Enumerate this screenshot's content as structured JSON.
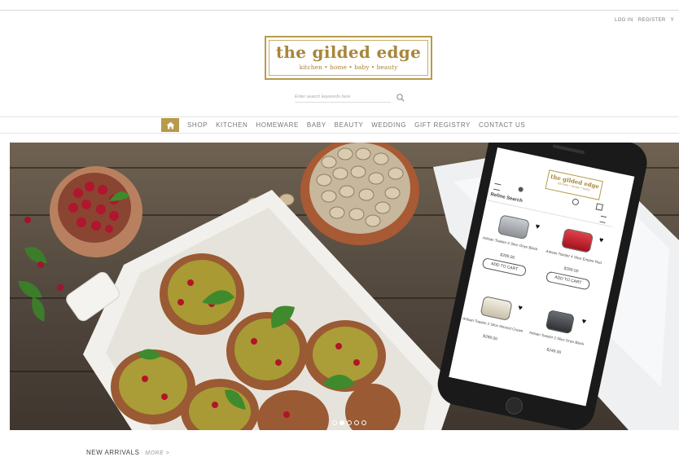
{
  "header": {
    "login": "LOG IN",
    "register": "REGISTER",
    "cart_glyph": "Y"
  },
  "logo": {
    "name": "the gilded edge",
    "tagline": "kitchen • home • baby • beauty"
  },
  "search": {
    "placeholder": "Enter search keywords here",
    "icon": "search-icon"
  },
  "nav": {
    "home_icon": "home-icon",
    "items": [
      "SHOP",
      "KITCHEN",
      "HOMEWARE",
      "BABY",
      "BEAUTY",
      "WEDDING",
      "GIFT REGISTRY",
      "CONTACT US"
    ]
  },
  "hero": {
    "slide_count": 5,
    "active_slide": 1
  },
  "phone": {
    "logo_line1": "the gilded edge",
    "logo_line2": "kitchen • home • baby",
    "refine": "Refine Search",
    "products": [
      {
        "name": "Artisan Toaster 4 Slice Onyx Black",
        "price": "$299.00",
        "button": "ADD TO CART"
      },
      {
        "name": "Artisan Toaster 4 Slice Empire Red",
        "price": "$299.00",
        "button": "ADD TO CART"
      },
      {
        "name": "Artisan Toaster 2 Slice Almond Cream",
        "price": "$299.00",
        "button": ""
      },
      {
        "name": "Artisan Toaster 2 Slice Onyx Black",
        "price": "$249.00",
        "button": ""
      }
    ]
  },
  "new_arrivals": {
    "title": "NEW ARRIVALS",
    "more": "MORE >"
  },
  "colors": {
    "gold": "#b89a4b",
    "nav_text": "#777777"
  }
}
